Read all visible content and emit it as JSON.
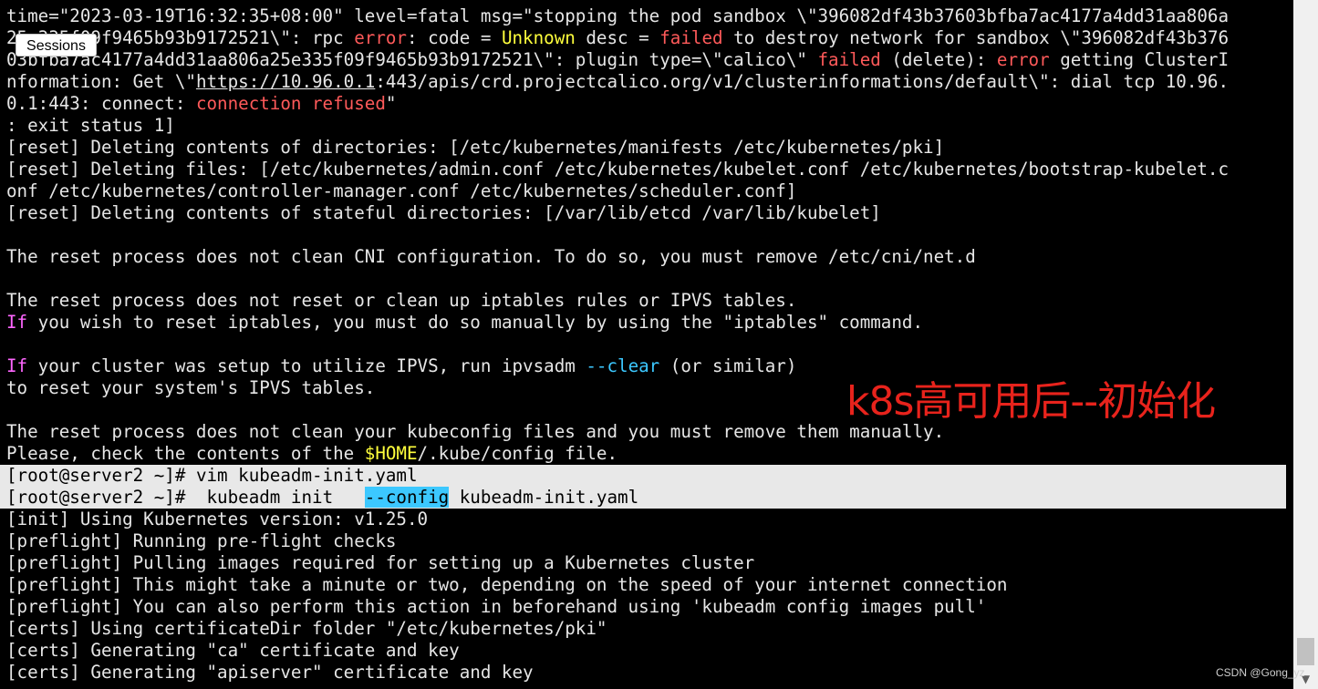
{
  "sessions_tab": {
    "label": "Sessions"
  },
  "annotation": {
    "text": "k8s高可用后--初始化",
    "color": "#e8231c"
  },
  "watermark": {
    "text": "CSDN @Gong_yz"
  },
  "colors": {
    "background": "#000000",
    "foreground": "#e6e6e6",
    "error": "#ff5a5a",
    "warning": "#ffff3c",
    "keyword": "#ff66ff",
    "option": "#3cc8ff",
    "highlight_row": "#e8e8e8"
  },
  "terminal": {
    "lines": [
      {
        "segments": [
          {
            "t": "time=\"2023-03-19T16:32:35+08:00\" level=fatal msg=\"stopping the pod sandbox \\\"396082df43b37603bfba7ac4177a4dd31aa806a"
          }
        ]
      },
      {
        "segments": [
          {
            "t": "25e335f09f9465b93b9172521\\\": rpc "
          },
          {
            "t": "error",
            "c": "error"
          },
          {
            "t": ": code = "
          },
          {
            "t": "Unknown",
            "c": "warn"
          },
          {
            "t": " desc = "
          },
          {
            "t": "failed",
            "c": "error"
          },
          {
            "t": " to destroy network for sandbox \\\"396082df43b376"
          }
        ]
      },
      {
        "segments": [
          {
            "t": "03bfba7ac4177a4dd31aa806a25e335f09f9465b93b9172521\\\": plugin type=\\\"calico\\\" "
          },
          {
            "t": "failed",
            "c": "error"
          },
          {
            "t": " (delete): "
          },
          {
            "t": "error",
            "c": "error"
          },
          {
            "t": " getting ClusterI"
          }
        ]
      },
      {
        "segments": [
          {
            "t": "nformation: Get \\\""
          },
          {
            "t": "https://10.96.0.1",
            "c": "link"
          },
          {
            "t": ":443/apis/crd.projectcalico.org/v1/clusterinformations/default\\\": dial tcp 10.96."
          }
        ]
      },
      {
        "segments": [
          {
            "t": "0.1:443: connect: "
          },
          {
            "t": "connection refused",
            "c": "error"
          },
          {
            "t": "\""
          }
        ]
      },
      {
        "segments": [
          {
            "t": ": exit status 1]"
          }
        ]
      },
      {
        "segments": [
          {
            "t": "[reset] Deleting contents of directories: [/etc/kubernetes/manifests /etc/kubernetes/pki]"
          }
        ]
      },
      {
        "segments": [
          {
            "t": "[reset] Deleting files: [/etc/kubernetes/admin.conf /etc/kubernetes/kubelet.conf /etc/kubernetes/bootstrap-kubelet.c"
          }
        ]
      },
      {
        "segments": [
          {
            "t": "onf /etc/kubernetes/controller-manager.conf /etc/kubernetes/scheduler.conf]"
          }
        ]
      },
      {
        "segments": [
          {
            "t": "[reset] Deleting contents of stateful directories: [/var/lib/etcd /var/lib/kubelet]"
          }
        ]
      },
      {
        "segments": [
          {
            "t": ""
          }
        ]
      },
      {
        "segments": [
          {
            "t": "The reset process does not clean CNI configuration. To do so, you must remove /etc/cni/net.d"
          }
        ]
      },
      {
        "segments": [
          {
            "t": ""
          }
        ]
      },
      {
        "segments": [
          {
            "t": "The reset process does not reset or clean up iptables rules or IPVS tables."
          }
        ]
      },
      {
        "segments": [
          {
            "t": "If",
            "c": "key"
          },
          {
            "t": " you wish to reset iptables, you must do so manually by using the \"iptables\" command."
          }
        ]
      },
      {
        "segments": [
          {
            "t": ""
          }
        ]
      },
      {
        "segments": [
          {
            "t": "If",
            "c": "key"
          },
          {
            "t": " your cluster was setup to utilize IPVS, run ipvsadm "
          },
          {
            "t": "--clear",
            "c": "cyan"
          },
          {
            "t": " (or similar)"
          }
        ]
      },
      {
        "segments": [
          {
            "t": "to reset your system's IPVS tables."
          }
        ]
      },
      {
        "segments": [
          {
            "t": ""
          }
        ]
      },
      {
        "segments": [
          {
            "t": "The reset process does not clean your kubeconfig files and you must remove them manually."
          }
        ]
      },
      {
        "segments": [
          {
            "t": "Please, check the contents of the "
          },
          {
            "t": "$HOME",
            "c": "warn"
          },
          {
            "t": "/.kube/config file."
          }
        ]
      },
      {
        "highlight": true,
        "segments": [
          {
            "t": "[root@server2 ~]# "
          },
          {
            "t": "vim kubeadm-init.yaml"
          }
        ]
      },
      {
        "highlight": true,
        "segments": [
          {
            "t": "[root@server2 ~]#  "
          },
          {
            "t": "kubeadm init   "
          },
          {
            "t": "--config",
            "c": "sel"
          },
          {
            "t": " kubeadm-init.yaml"
          }
        ]
      },
      {
        "segments": [
          {
            "t": "[init] Using Kubernetes version: v1.25.0"
          }
        ]
      },
      {
        "segments": [
          {
            "t": "[preflight] Running pre-flight checks"
          }
        ]
      },
      {
        "segments": [
          {
            "t": "[preflight] Pulling images required for setting up a Kubernetes cluster"
          }
        ]
      },
      {
        "segments": [
          {
            "t": "[preflight] This might take a minute or two, depending on the speed of your internet connection"
          }
        ]
      },
      {
        "segments": [
          {
            "t": "[preflight] You can also perform this action in beforehand using 'kubeadm config images pull'"
          }
        ]
      },
      {
        "segments": [
          {
            "t": "[certs] Using certificateDir folder \"/etc/kubernetes/pki\""
          }
        ]
      },
      {
        "segments": [
          {
            "t": "[certs] Generating \"ca\" certificate and key"
          }
        ]
      },
      {
        "segments": [
          {
            "t": "[certs] Generating \"apiserver\" certificate and key"
          }
        ]
      }
    ]
  }
}
